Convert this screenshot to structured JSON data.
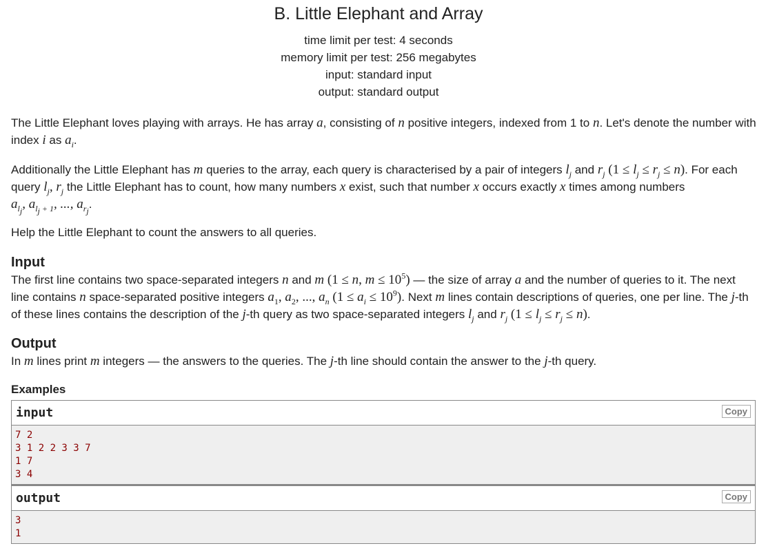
{
  "header": {
    "title": "B. Little Elephant and Array",
    "time_limit": "time limit per test: 4 seconds",
    "memory_limit": "memory limit per test: 256 megabytes",
    "input": "input: standard input",
    "output": "output: standard output"
  },
  "statement": {
    "p1_a": "The Little Elephant loves playing with arrays. He has array ",
    "p1_b": ", consisting of ",
    "p1_c": " positive integers, indexed from 1 to ",
    "p1_d": ". Let's denote the number with index ",
    "p1_e": " as ",
    "p2_a": "Additionally the Little Elephant has ",
    "p2_b": " queries to the array, each query is characterised by a pair of integers ",
    "p2_c": " and ",
    "p2_d": ". For each query ",
    "p2_e": " the Little Elephant has to count, how many numbers ",
    "p2_f": " exist, such that number ",
    "p2_g": " occurs exactly ",
    "p2_h": " times among numbers ",
    "p3": "Help the Little Elephant to count the answers to all queries."
  },
  "input_section": {
    "title": "Input",
    "t1": "The first line contains two space-separated integers ",
    "t2": " and ",
    "t3": " — the size of array ",
    "t4": " and the number of queries to it. The next line contains ",
    "t5": " space-separated positive integers ",
    "t6": ". Next ",
    "t7": " lines contain descriptions of queries, one per line. The ",
    "t8": "-th of these lines contains the description of the ",
    "t9": "-th query as two space-separated integers ",
    "t10": " and "
  },
  "output_section": {
    "title": "Output",
    "t1": "In ",
    "t2": " lines print ",
    "t3": " integers — the answers to the queries. The ",
    "t4": "-th line should contain the answer to the ",
    "t5": "-th query."
  },
  "examples": {
    "title": "Examples",
    "input_label": "input",
    "output_label": "output",
    "copy_label": "Copy",
    "input_text": "7 2\n3 1 2 2 3 3 7\n1 7\n3 4",
    "output_text": "3\n1"
  }
}
